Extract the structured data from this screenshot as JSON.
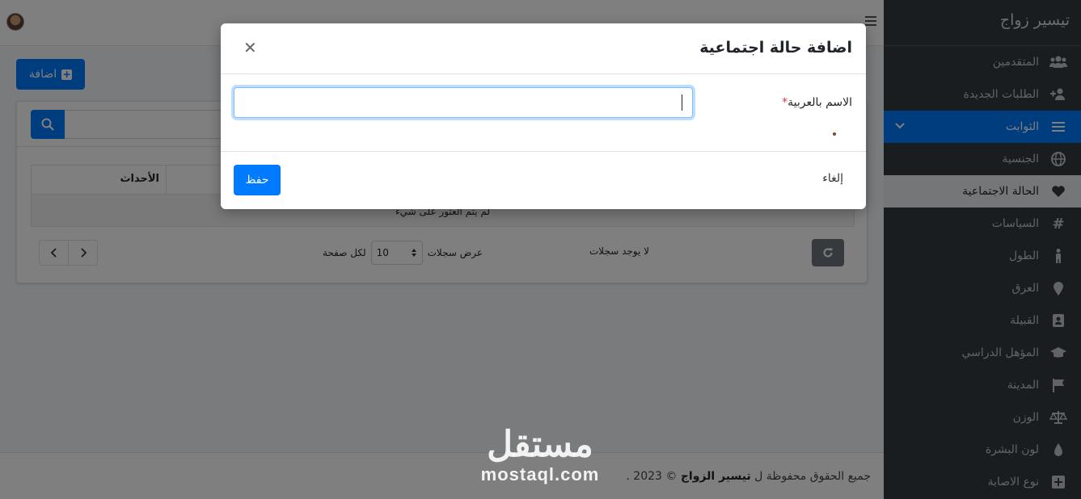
{
  "brand": {
    "title": "تيسير زواج"
  },
  "sidebar": {
    "items": [
      {
        "label": "المتقدمين",
        "icon": "users-icon"
      },
      {
        "label": "الطلبات الجديدة",
        "icon": "user-plus-icon"
      },
      {
        "label": "الثوابت",
        "icon": "bars-icon"
      },
      {
        "label": "الجنسية",
        "icon": "globe-icon"
      },
      {
        "label": "الحالة الاجتماعية",
        "icon": "heart-icon"
      },
      {
        "label": "السياسات",
        "icon": "hashtag-icon"
      },
      {
        "label": "الطول",
        "icon": "person-icon"
      },
      {
        "label": "العرق",
        "icon": "map-marker-icon"
      },
      {
        "label": "القبيلة",
        "icon": "id-card-icon"
      },
      {
        "label": "المؤهل الدراسي",
        "icon": "graduation-cap-icon"
      },
      {
        "label": "المدينة",
        "icon": "flag-icon"
      },
      {
        "label": "الوزن",
        "icon": "scale-icon"
      },
      {
        "label": "لون البشرة",
        "icon": "droplet-icon"
      },
      {
        "label": "نوع الاصابة",
        "icon": "plus-square-icon"
      }
    ]
  },
  "page": {
    "add_label": "اضافة",
    "table_header_actions": "الأحداث",
    "empty_text": "لم يتم العثور على شيء",
    "per_page_prefix": "عرض سجلات",
    "per_page_value": "10",
    "per_page_suffix": "لكل صفحة",
    "no_records": "لا يوجد سجلات"
  },
  "footer": {
    "text_prefix": "جميع الحقوق محفوظة ل",
    "brand": "تيسير الزواج",
    "text_suffix": "© 2023 ."
  },
  "watermark": {
    "arabic": "مستقل",
    "latin": "mostaql.com"
  },
  "modal": {
    "title": "اضافة حالة اجتماعية",
    "field_label": "الاسم بالعربية",
    "required_mark": "*",
    "input_value": "",
    "save_label": "حفظ",
    "cancel_label": "إلغاء"
  },
  "colors": {
    "primary": "#007bff",
    "sidebar_bg": "#343a40",
    "backdrop": "rgba(0,0,0,0.5)"
  }
}
